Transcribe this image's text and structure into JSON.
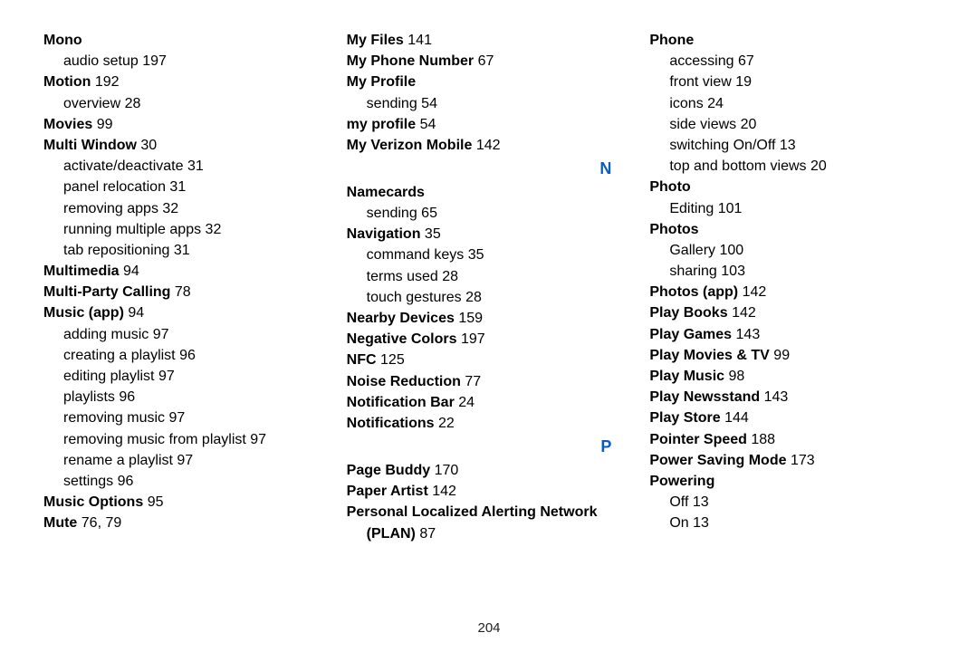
{
  "page_number": "204",
  "columns": [
    [
      {
        "type": "head",
        "text": "Mono"
      },
      {
        "type": "sub",
        "text": "audio setup",
        "pages": "197"
      },
      {
        "type": "head",
        "text": "Motion",
        "pages": "192"
      },
      {
        "type": "sub",
        "text": "overview",
        "pages": "28"
      },
      {
        "type": "head",
        "text": "Movies",
        "pages": "99"
      },
      {
        "type": "head",
        "text": "Multi Window",
        "pages": "30"
      },
      {
        "type": "sub",
        "text": "activate/deactivate",
        "pages": "31"
      },
      {
        "type": "sub",
        "text": "panel relocation",
        "pages": "31"
      },
      {
        "type": "sub",
        "text": "removing apps",
        "pages": "32"
      },
      {
        "type": "sub",
        "text": "running multiple apps",
        "pages": "32"
      },
      {
        "type": "sub",
        "text": "tab repositioning",
        "pages": "31"
      },
      {
        "type": "head",
        "text": "Multimedia",
        "pages": "94"
      },
      {
        "type": "head",
        "text": "Multi-Party Calling",
        "pages": "78"
      },
      {
        "type": "head",
        "text": "Music (app)",
        "pages": "94"
      },
      {
        "type": "sub",
        "text": "adding music",
        "pages": "97"
      },
      {
        "type": "sub",
        "text": "creating a playlist",
        "pages": "96"
      },
      {
        "type": "sub",
        "text": "editing playlist",
        "pages": "97"
      },
      {
        "type": "sub",
        "text": "playlists",
        "pages": "96"
      },
      {
        "type": "sub",
        "text": "removing music",
        "pages": "97"
      },
      {
        "type": "sub",
        "text": "removing music from playlist",
        "pages": "97"
      },
      {
        "type": "sub",
        "text": "rename a playlist",
        "pages": "97"
      },
      {
        "type": "sub",
        "text": "settings",
        "pages": "96"
      },
      {
        "type": "head",
        "text": "Music Options",
        "pages": "95"
      },
      {
        "type": "head",
        "text": "Mute",
        "pages": "76, 79"
      }
    ],
    [
      {
        "type": "head",
        "text": "My Files",
        "pages": "141"
      },
      {
        "type": "head",
        "text": "My Phone Number",
        "pages": "67"
      },
      {
        "type": "head",
        "text": "My Profile"
      },
      {
        "type": "sub",
        "text": "sending",
        "pages": "54"
      },
      {
        "type": "head",
        "text": "my profile",
        "pages": "54"
      },
      {
        "type": "head",
        "text": "My Verizon Mobile",
        "pages": "142"
      },
      {
        "type": "letter",
        "text": "N"
      },
      {
        "type": "head",
        "text": "Namecards"
      },
      {
        "type": "sub",
        "text": "sending",
        "pages": "65"
      },
      {
        "type": "head",
        "text": "Navigation",
        "pages": "35"
      },
      {
        "type": "sub",
        "text": "command keys",
        "pages": "35"
      },
      {
        "type": "sub",
        "text": "terms used",
        "pages": "28"
      },
      {
        "type": "sub",
        "text": "touch gestures",
        "pages": "28"
      },
      {
        "type": "head",
        "text": "Nearby Devices",
        "pages": "159"
      },
      {
        "type": "head",
        "text": "Negative Colors",
        "pages": "197"
      },
      {
        "type": "head",
        "text": "NFC",
        "pages": "125"
      },
      {
        "type": "head",
        "text": "Noise Reduction",
        "pages": "77"
      },
      {
        "type": "head",
        "text": "Notification Bar",
        "pages": "24"
      },
      {
        "type": "head",
        "text": "Notifications",
        "pages": "22"
      },
      {
        "type": "letter",
        "text": "P"
      },
      {
        "type": "head",
        "text": "Page Buddy",
        "pages": "170"
      },
      {
        "type": "head",
        "text": "Paper Artist",
        "pages": "142"
      },
      {
        "type": "head",
        "text": "Personal Localized Alerting Network"
      },
      {
        "type": "sub-head",
        "text": "(PLAN)",
        "pages": "87"
      }
    ],
    [
      {
        "type": "head",
        "text": "Phone"
      },
      {
        "type": "sub",
        "text": "accessing",
        "pages": "67"
      },
      {
        "type": "sub",
        "text": "front view",
        "pages": "19"
      },
      {
        "type": "sub",
        "text": "icons",
        "pages": "24"
      },
      {
        "type": "sub",
        "text": "side views",
        "pages": "20"
      },
      {
        "type": "sub",
        "text": "switching On/Off",
        "pages": "13"
      },
      {
        "type": "sub",
        "text": "top and bottom views",
        "pages": "20"
      },
      {
        "type": "head",
        "text": "Photo"
      },
      {
        "type": "sub",
        "text": "Editing",
        "pages": "101"
      },
      {
        "type": "head",
        "text": "Photos"
      },
      {
        "type": "sub",
        "text": "Gallery",
        "pages": "100"
      },
      {
        "type": "sub",
        "text": "sharing",
        "pages": "103"
      },
      {
        "type": "head",
        "text": "Photos (app)",
        "pages": "142"
      },
      {
        "type": "head",
        "text": "Play Books",
        "pages": "142"
      },
      {
        "type": "head",
        "text": "Play Games",
        "pages": "143"
      },
      {
        "type": "head",
        "text": "Play Movies & TV",
        "pages": "99"
      },
      {
        "type": "head",
        "text": "Play Music",
        "pages": "98"
      },
      {
        "type": "head",
        "text": "Play Newsstand",
        "pages": "143"
      },
      {
        "type": "head",
        "text": "Play Store",
        "pages": "144"
      },
      {
        "type": "head",
        "text": "Pointer Speed",
        "pages": "188"
      },
      {
        "type": "head",
        "text": "Power Saving Mode",
        "pages": "173"
      },
      {
        "type": "head",
        "text": "Powering"
      },
      {
        "type": "sub",
        "text": "Off",
        "pages": "13"
      },
      {
        "type": "sub",
        "text": "On",
        "pages": "13"
      }
    ]
  ]
}
